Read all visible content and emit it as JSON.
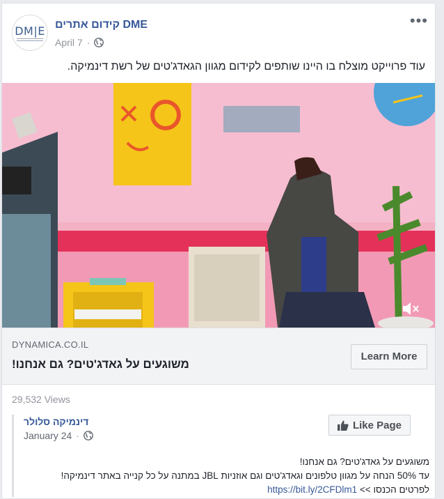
{
  "post": {
    "page_name": "קידום אתרים DME",
    "date": "April 7",
    "privacy_icon": "globe-icon",
    "more_icon": "more-options-icon",
    "more_glyph": "•••",
    "text": "עוד פרוייקט מוצלח בו היינו שותפים לקידום מגוון הגאדג'טים של רשת דינמיקה.",
    "avatar_logo": "DM|E"
  },
  "video": {
    "mute_icon": "volume-muted-icon"
  },
  "link_preview": {
    "domain": "DYNAMICA.CO.IL",
    "title": "משוגעים על גאדג'טים? גם אנחנו!",
    "cta_label": "Learn More"
  },
  "stats": {
    "views": "29,532 Views"
  },
  "shared_post": {
    "page_name": "דינמיקה סלולר",
    "date": "January 24",
    "like_page_label": "Like Page",
    "line1": "משוגעים על גאדג'טים? גם אנחנו!",
    "line2": "עד 50% הנחה על מגוון טלפונים וגאדג'טים וגם אוזניות JBL במתנה על כל קנייה באתר דינמיקה!",
    "line3_prefix": "לפרטים הכנסו >>",
    "line3_link": "https://bit.ly/2CFDlm1"
  },
  "colors": {
    "link_blue": "#365899",
    "muted_gray": "#90949c",
    "video_wall_pink": "#f2a9bf"
  }
}
